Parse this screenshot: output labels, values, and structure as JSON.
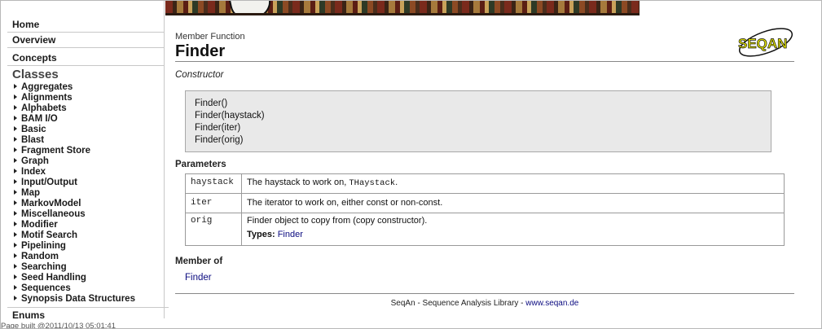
{
  "sidebar": {
    "top_links": [
      "Home",
      "Overview",
      "Concepts"
    ],
    "classes_heading": "Classes",
    "classes": [
      "Aggregates",
      "Alignments",
      "Alphabets",
      "BAM I/O",
      "Basic",
      "Blast",
      "Fragment Store",
      "Graph",
      "Index",
      "Input/Output",
      "Map",
      "MarkovModel",
      "Miscellaneous",
      "Modifier",
      "Motif Search",
      "Pipelining",
      "Random",
      "Searching",
      "Seed Handling",
      "Sequences",
      "Synopsis Data Structures"
    ],
    "enums": "Enums",
    "page_built": "Page built @2011/10/13 05:01:41"
  },
  "logo": {
    "text": "SEQAN",
    "color": "#d8d800"
  },
  "main": {
    "kind": "Member Function",
    "title": "Finder",
    "subtitle": "Constructor",
    "signatures": [
      "Finder()",
      "Finder(haystack)",
      "Finder(iter)",
      "Finder(orig)"
    ],
    "parameters_heading": "Parameters",
    "parameters": [
      {
        "name": "haystack",
        "desc_prefix": "The haystack to work on, ",
        "desc_code": "THaystack",
        "desc_suffix": "."
      },
      {
        "name": "iter",
        "desc": "The iterator to work on, either const or non-const."
      },
      {
        "name": "orig",
        "desc": "Finder object to copy from (copy constructor).",
        "types_label": "Types:",
        "types_link": "Finder"
      }
    ],
    "member_of_heading": "Member of",
    "member_of_link": "Finder"
  },
  "footer": {
    "text": "SeqAn - Sequence Analysis Library - ",
    "link": "www.seqan.de"
  },
  "colors": {
    "link": "#0b0b80",
    "signature_bg": "#e9e9e9",
    "rule": "#888888"
  }
}
